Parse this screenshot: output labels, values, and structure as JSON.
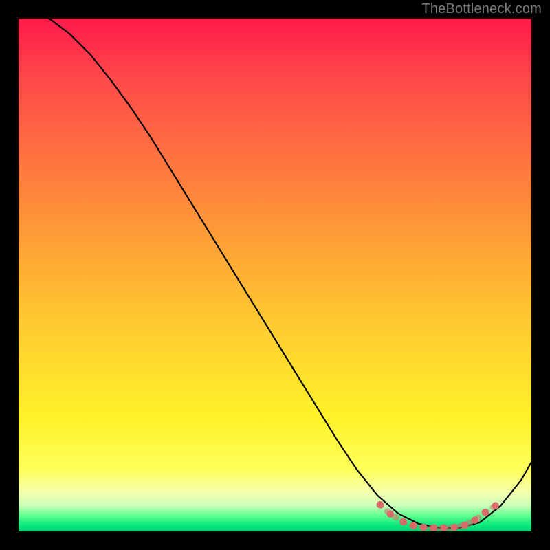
{
  "attribution": "TheBottleneck.com",
  "chart_data": {
    "type": "line",
    "title": "",
    "xlabel": "",
    "ylabel": "",
    "xlim": [
      0,
      100
    ],
    "ylim": [
      0,
      100
    ],
    "series": [
      {
        "name": "curve",
        "x": [
          6,
          10,
          14,
          18,
          22,
          26,
          30,
          34,
          38,
          42,
          46,
          50,
          54,
          58,
          62,
          66,
          70,
          74,
          78,
          82,
          86,
          90,
          94,
          98,
          100
        ],
        "y": [
          100,
          97,
          93,
          88,
          82.5,
          76.5,
          70,
          63.5,
          57,
          50.5,
          44,
          37.5,
          31,
          24.5,
          18,
          12,
          7,
          3.5,
          1.5,
          0.7,
          0.7,
          1.8,
          5,
          10,
          13.5
        ]
      }
    ],
    "markers": {
      "name": "highlight-dots",
      "color": "#d96a6a",
      "x": [
        70.5,
        72.5,
        75,
        77,
        79,
        81,
        83,
        85,
        87,
        89,
        91,
        93
      ],
      "y": [
        5.2,
        3.4,
        1.9,
        1.1,
        0.8,
        0.7,
        0.7,
        0.8,
        1.2,
        2.2,
        3.7,
        5.0
      ]
    }
  }
}
